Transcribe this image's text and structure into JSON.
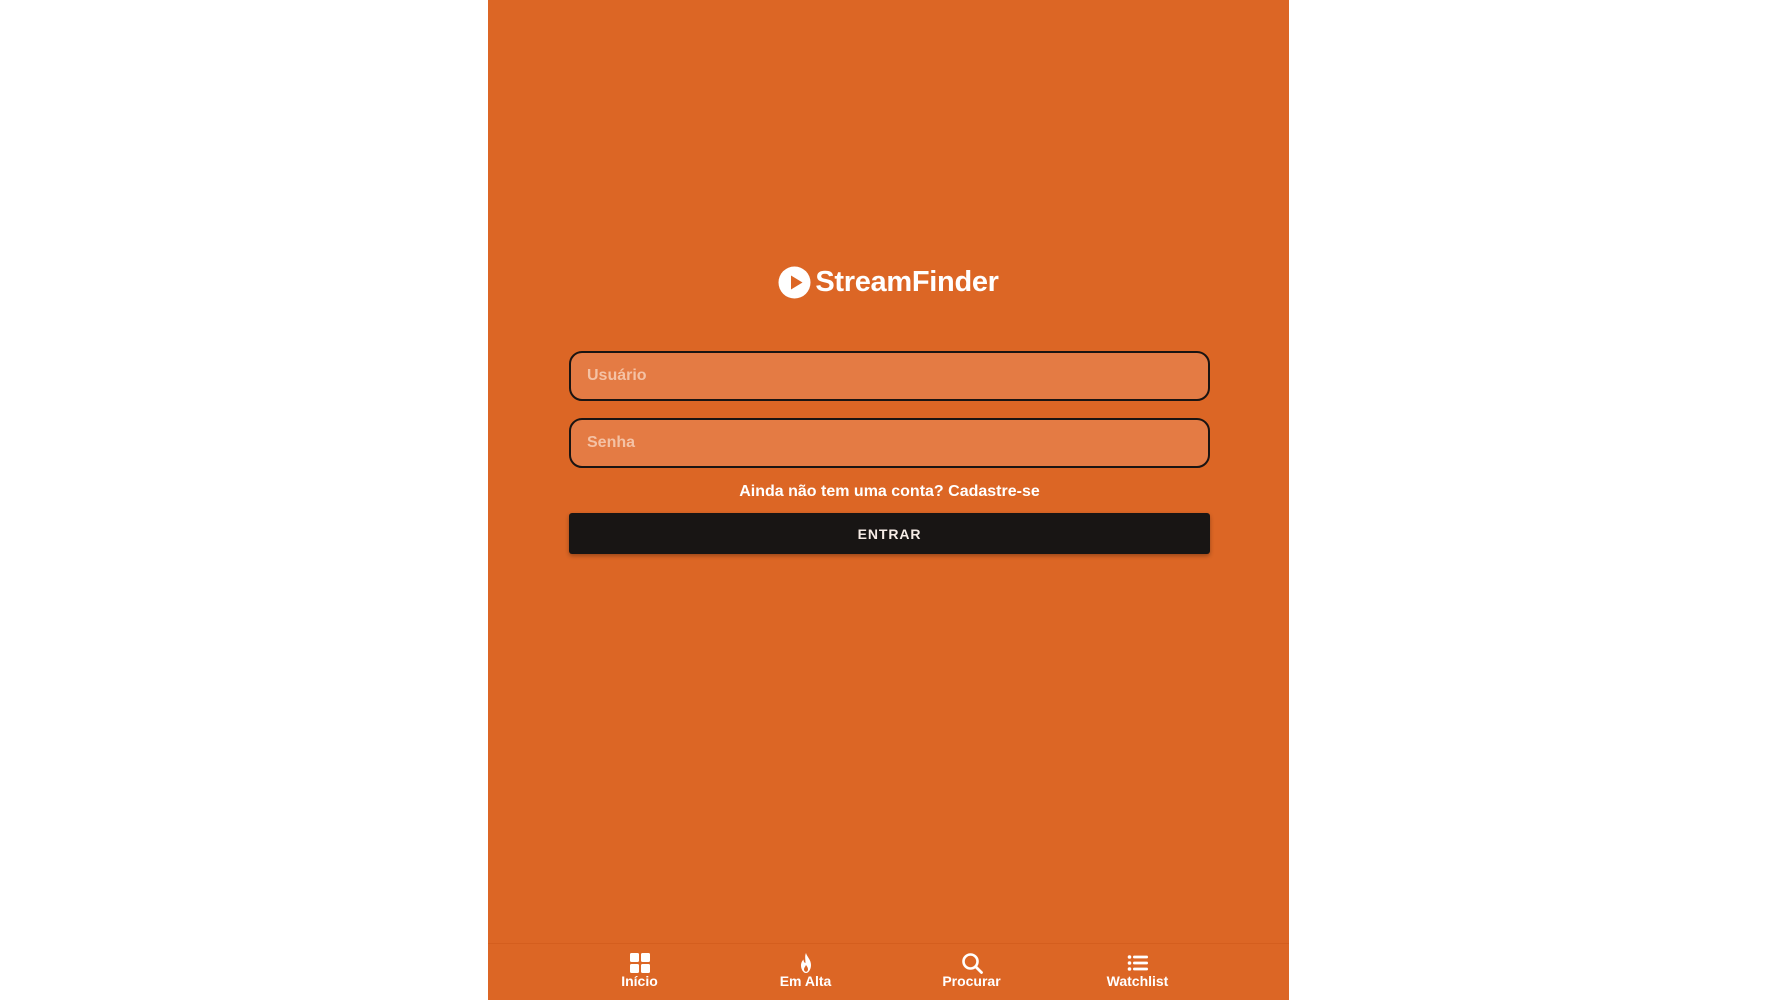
{
  "app": {
    "brand_name": "StreamFinder",
    "background_color": "#dc6625",
    "logo_icon": "play-circle-icon"
  },
  "login_form": {
    "username_placeholder": "Usuário",
    "password_placeholder": "Senha",
    "signup_text": "Ainda não tem uma conta? Cadastre-se",
    "submit_label": "ENTRAR"
  },
  "bottom_nav": {
    "items": [
      {
        "label": "Início",
        "icon": "grid-icon"
      },
      {
        "label": "Em Alta",
        "icon": "flame-icon"
      },
      {
        "label": "Procurar",
        "icon": "search-icon"
      },
      {
        "label": "Watchlist",
        "icon": "list-icon"
      }
    ]
  }
}
